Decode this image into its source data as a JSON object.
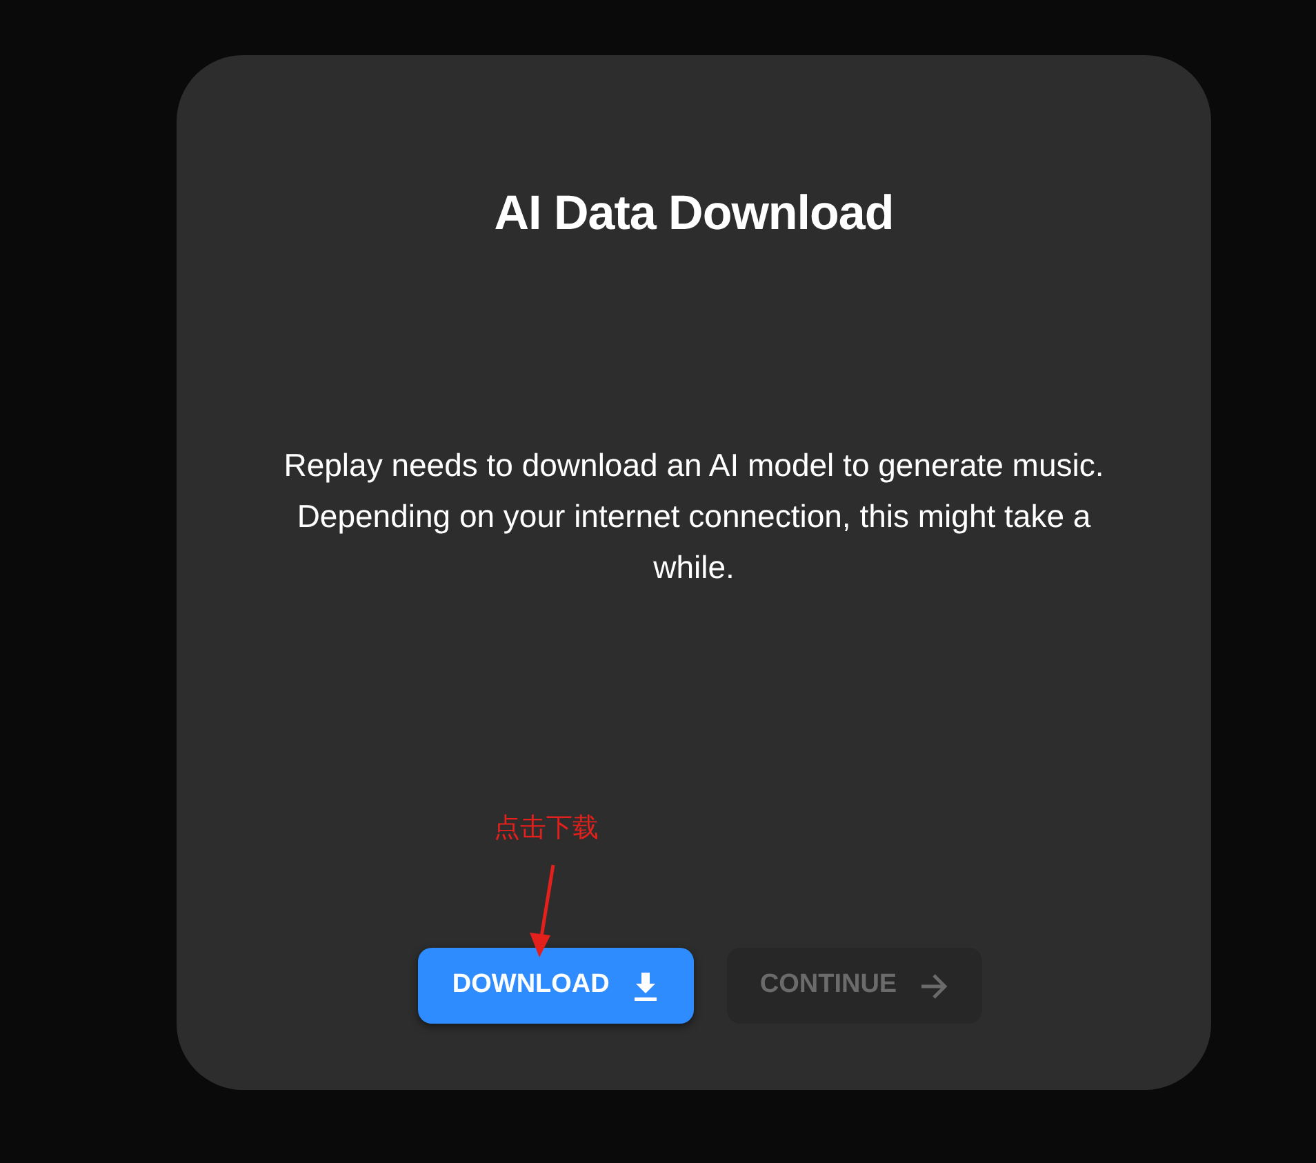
{
  "dialog": {
    "title": "AI Data Download",
    "message": "Replay needs to download an AI model to generate music. Depending on your internet connection, this might take a while."
  },
  "buttons": [
    {
      "label": "DOWNLOAD",
      "kind": "download",
      "disabled": false
    },
    {
      "label": "CONTINUE",
      "kind": "continue",
      "disabled": true
    }
  ],
  "annotation": {
    "text": "点击下载"
  }
}
